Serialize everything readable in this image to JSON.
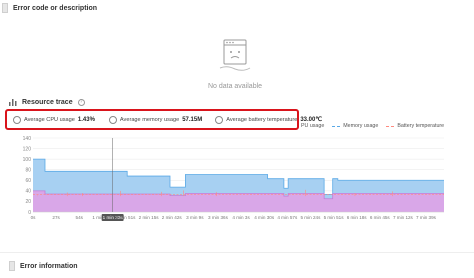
{
  "error_section": {
    "title": "Error code or description",
    "empty_text": "No data available"
  },
  "trace_section": {
    "title": "Resource trace",
    "info_glyph": "?"
  },
  "metrics": {
    "cpu": {
      "label": "Average CPU usage",
      "value": "1.43%"
    },
    "memory": {
      "label": "Average memory usage",
      "value": "57.15M"
    },
    "battery": {
      "label": "Average battery temperature",
      "value": "33.00℃"
    }
  },
  "legend": {
    "cpu": {
      "label": "PU usage",
      "color": "#c77ad6"
    },
    "memory": {
      "label": "Memory usage",
      "color": "#5aa9e6"
    },
    "battery": {
      "label": "Battery temperature",
      "color": "#ff8a80"
    }
  },
  "chart_data": {
    "type": "area",
    "ylim": [
      0,
      140
    ],
    "yticks": [
      0,
      20,
      40,
      60,
      80,
      100,
      120,
      140
    ],
    "xlim": [
      0,
      480
    ],
    "xticks": [
      {
        "t": 0,
        "label": "0s"
      },
      {
        "t": 27,
        "label": "27s"
      },
      {
        "t": 54,
        "label": "54s"
      },
      {
        "t": 81,
        "label": "1 min 21s"
      },
      {
        "t": 93,
        "label": "1 min 33s"
      },
      {
        "t": 108,
        "label": "1 min 51s"
      },
      {
        "t": 135,
        "label": "2 min 15s"
      },
      {
        "t": 162,
        "label": "2 min 42s"
      },
      {
        "t": 189,
        "label": "3 min 9s"
      },
      {
        "t": 216,
        "label": "3 min 36s"
      },
      {
        "t": 243,
        "label": "4 min 3s"
      },
      {
        "t": 270,
        "label": "4 min 30s"
      },
      {
        "t": 297,
        "label": "4 min 57s"
      },
      {
        "t": 324,
        "label": "5 min 24s"
      },
      {
        "t": 351,
        "label": "5 min 51s"
      },
      {
        "t": 378,
        "label": "6 min 18s"
      },
      {
        "t": 405,
        "label": "6 min 45s"
      },
      {
        "t": 432,
        "label": "7 min 12s"
      },
      {
        "t": 459,
        "label": "7 min 39s"
      }
    ],
    "highlight_tick": "1 min 33s",
    "series": [
      {
        "name": "Memory usage",
        "x": [
          0,
          14,
          14,
          110,
          110,
          160,
          160,
          178,
          178,
          274,
          274,
          293,
          293,
          298,
          298,
          340,
          340,
          350,
          350,
          356,
          356,
          482
        ],
        "y": [
          100,
          100,
          77,
          77,
          68,
          68,
          47,
          47,
          71,
          71,
          63,
          63,
          45,
          45,
          63,
          63,
          33,
          33,
          63,
          63,
          60,
          60
        ]
      },
      {
        "name": "CPU usage",
        "x": [
          0,
          14,
          14,
          160,
          160,
          178,
          178,
          293,
          293,
          298,
          298,
          340,
          340,
          350,
          350,
          482
        ],
        "y": [
          40,
          40,
          34,
          34,
          31,
          31,
          35,
          35,
          30,
          30,
          35,
          35,
          25,
          25,
          35,
          35
        ]
      },
      {
        "name": "Battery temperature",
        "x": [
          0,
          482
        ],
        "y": [
          33,
          33
        ]
      }
    ]
  }
}
